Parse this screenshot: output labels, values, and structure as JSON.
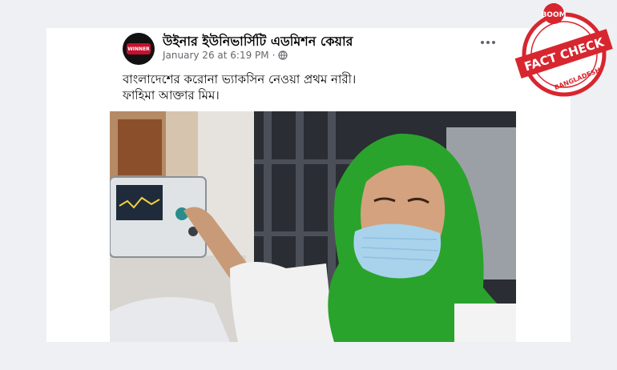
{
  "post": {
    "page_name": "উইনার ইউনিভার্সিটি এডমিশন কেয়ার",
    "timestamp": "January 26 at 6:19 PM",
    "separator": "·",
    "text_line_1": "বাংলাদেশের করোনা ভ্যাকসিন নেওয়া প্রথম নারী।",
    "text_line_2": "ফাহিমা আক্তার মিম।",
    "avatar_text": "WINNER",
    "icons": {
      "privacy": "globe-icon",
      "menu": "more-options-icon"
    }
  },
  "badge": {
    "top_text": "BOOM",
    "main_text": "FACT CHECK",
    "bottom_text": "BANGLADESH",
    "color": "#d7262f"
  },
  "colors": {
    "background": "#eef0f3",
    "hijab": "#2aa32c",
    "mask": "#a9d3ec",
    "brand_red": "#d7262f"
  }
}
